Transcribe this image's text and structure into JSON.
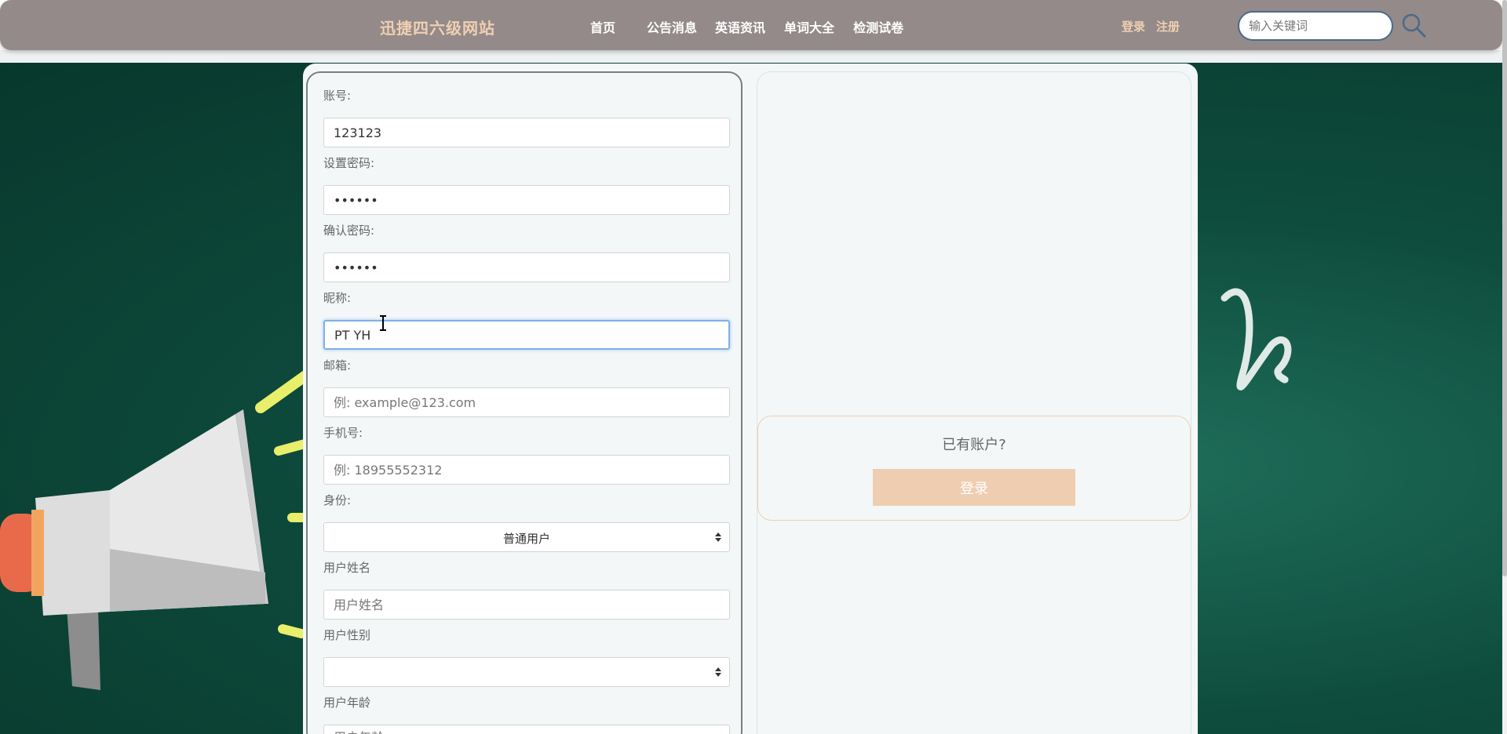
{
  "header": {
    "brand": "迅捷四六级网站",
    "nav": [
      "首页",
      "公告消息",
      "英语资讯",
      "单词大全",
      "检测试卷"
    ],
    "login_link": "登录",
    "register_link": "注册",
    "search_placeholder": "输入关键词",
    "search_icon": "search-icon"
  },
  "form": {
    "fields": [
      {
        "label": "账号:",
        "value": "123123",
        "placeholder": ""
      },
      {
        "label": "设置密码:",
        "value": "••••••",
        "placeholder": ""
      },
      {
        "label": "确认密码:",
        "value": "••••••",
        "placeholder": ""
      },
      {
        "label": "昵称:",
        "value": "PT YH",
        "placeholder": ""
      },
      {
        "label": "邮箱:",
        "value": "",
        "placeholder": "例: example@123.com"
      },
      {
        "label": "手机号:",
        "value": "",
        "placeholder": "例: 18955552312"
      },
      {
        "label": "身份:",
        "selected": "普通用户"
      },
      {
        "label": "用户姓名",
        "value": "",
        "placeholder": "用户姓名"
      },
      {
        "label": "用户性别",
        "selected": ""
      },
      {
        "label": "用户年龄",
        "value": "",
        "placeholder": "用户年龄"
      }
    ]
  },
  "login_panel": {
    "question": "已有账户?",
    "button_label": "登录"
  },
  "colors": {
    "navbar": "#948a89",
    "accent": "#efcfb3",
    "background": "#0e4c3d"
  }
}
